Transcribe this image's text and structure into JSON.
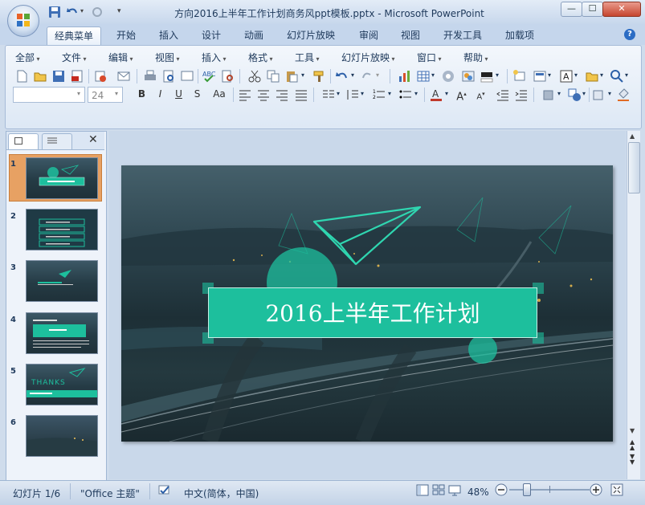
{
  "window": {
    "title": "方向2016上半年工作计划商务风ppt模板.pptx - Microsoft PowerPoint",
    "min_label": "—",
    "max_label": "☐",
    "close_label": "✕"
  },
  "ribbon_tabs": [
    "经典菜单",
    "开始",
    "插入",
    "设计",
    "动画",
    "幻灯片放映",
    "审阅",
    "视图",
    "开发工具",
    "加载项"
  ],
  "menu_items": [
    "全部",
    "文件",
    "编辑",
    "视图",
    "插入",
    "格式",
    "工具",
    "幻灯片放映",
    "窗口",
    "帮助"
  ],
  "font_name_value": "",
  "font_size_value": "24",
  "format_buttons": [
    "B",
    "I",
    "U",
    "S",
    "Aa"
  ],
  "help_label": "?",
  "slides": [
    {
      "number": "1",
      "selected": true
    },
    {
      "number": "2",
      "selected": false
    },
    {
      "number": "3",
      "selected": false
    },
    {
      "number": "4",
      "selected": false
    },
    {
      "number": "5",
      "selected": false
    },
    {
      "number": "6",
      "selected": false
    }
  ],
  "thumb5_text": "THANKS",
  "slide": {
    "title": "2016上半年工作计划"
  },
  "status": {
    "slide_position": "幻灯片 1/6",
    "theme": "\"Office 主题\"",
    "language": "中文(简体，中国)",
    "zoom": "48%"
  },
  "colors": {
    "accent_teal": "#1dbf9d",
    "slide_bg": "#2e4650",
    "selected_thumb": "#e7a163"
  }
}
